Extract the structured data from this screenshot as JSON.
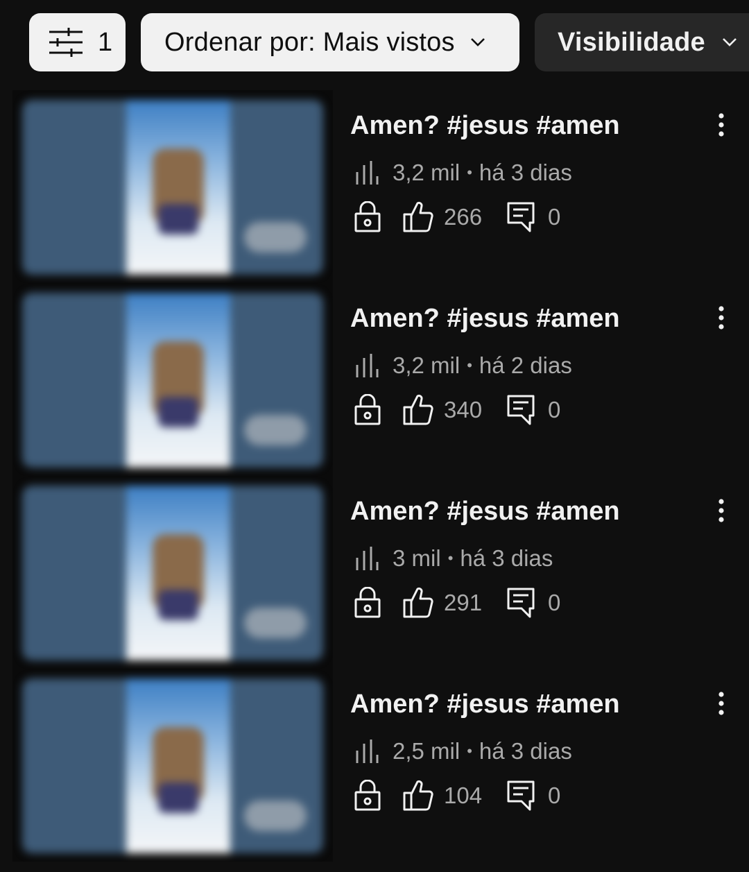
{
  "filter_bar": {
    "filter_chip": {
      "icon": "tune-icon",
      "count": "1"
    },
    "sort_chip": {
      "label": "Ordenar por: Mais vistos",
      "icon": "chevron-down-icon"
    },
    "visibility_chip": {
      "label": "Visibilidade",
      "icon": "chevron-down-icon"
    }
  },
  "videos": [
    {
      "title": "Amen? #jesus #amen",
      "views": "3,2 mil",
      "separator": "•",
      "age": "há 3 dias",
      "likes": "266",
      "comments": "0",
      "visibility": "lock-icon"
    },
    {
      "title": "Amen? #jesus #amen",
      "views": "3,2 mil",
      "separator": "•",
      "age": "há 2 dias",
      "likes": "340",
      "comments": "0",
      "visibility": "lock-icon"
    },
    {
      "title": "Amen? #jesus #amen",
      "views": "3 mil",
      "separator": "•",
      "age": "há 3 dias",
      "likes": "291",
      "comments": "0",
      "visibility": "lock-icon"
    },
    {
      "title": "Amen? #jesus #amen",
      "views": "2,5 mil",
      "separator": "•",
      "age": "há 3 dias",
      "likes": "104",
      "comments": "0",
      "visibility": "lock-icon"
    }
  ],
  "colors": {
    "background": "#0f0f0f",
    "chip_light": "#f1f1f1",
    "chip_dark": "#272727",
    "text_primary": "#f1f1f1",
    "text_secondary": "#aaaaaa"
  }
}
